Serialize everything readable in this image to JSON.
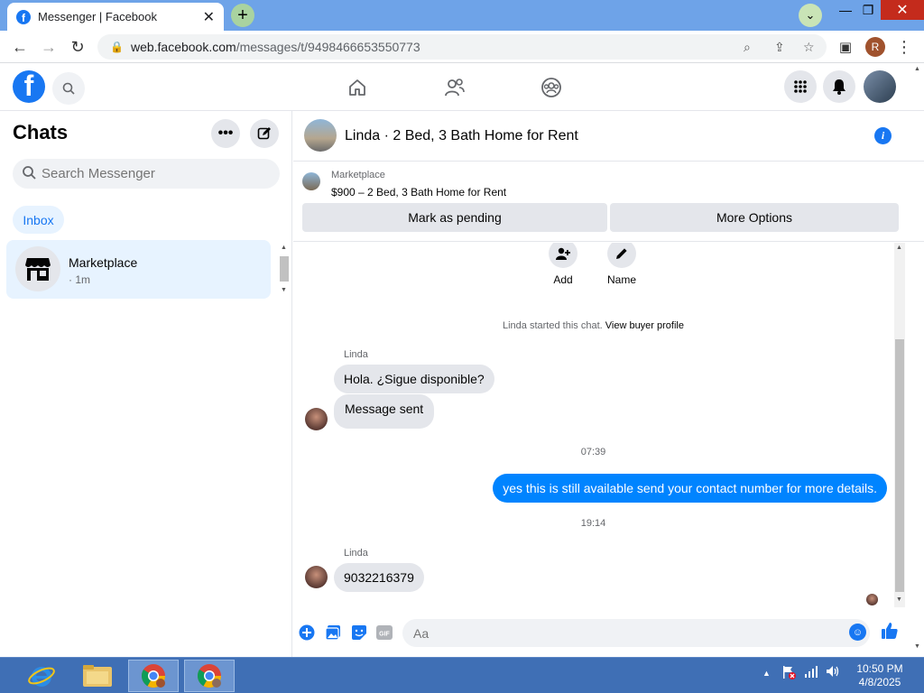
{
  "browser": {
    "tab_title": "Messenger | Facebook",
    "url_host": "web.facebook.com",
    "url_path": "/messages/t/9498466653550773",
    "profile_initial": "R"
  },
  "fb": {
    "logo_letter": "f"
  },
  "sidebar": {
    "title": "Chats",
    "search_placeholder": "Search Messenger",
    "filter": "Inbox",
    "chats": [
      {
        "name": "Marketplace",
        "time": "· 1m"
      }
    ]
  },
  "conversation": {
    "title": "Linda · 2 Bed, 3 Bath Home for Rent",
    "marketplace_label": "Marketplace",
    "listing": "$900 – 2 Bed, 3 Bath Home for Rent",
    "pending_button": "Mark as pending",
    "options_button": "More Options",
    "actions": [
      {
        "label": "Add",
        "icon": "add-person-icon"
      },
      {
        "label": "Name",
        "icon": "pencil-icon"
      }
    ],
    "started_text": "Linda started this chat.",
    "buyer_profile_link": "View buyer profile",
    "messages": [
      {
        "sender": "Linda",
        "text": "Hola. ¿Sigue disponible?"
      },
      {
        "text": "Message sent"
      },
      {
        "timestamp": "07:39"
      },
      {
        "text": "yes this is still available send your contact number for more details.",
        "mine": true
      },
      {
        "timestamp": "19:14"
      },
      {
        "sender": "Linda",
        "text": "9032216379"
      }
    ],
    "composer_placeholder": "Aa",
    "gif_label": "GIF"
  },
  "taskbar": {
    "time": "10:50 PM",
    "date": "4/8/2025"
  },
  "colors": {
    "accent": "#1877f2",
    "my_bubble": "#0084ff",
    "taskbar": "#3f6fb5"
  }
}
